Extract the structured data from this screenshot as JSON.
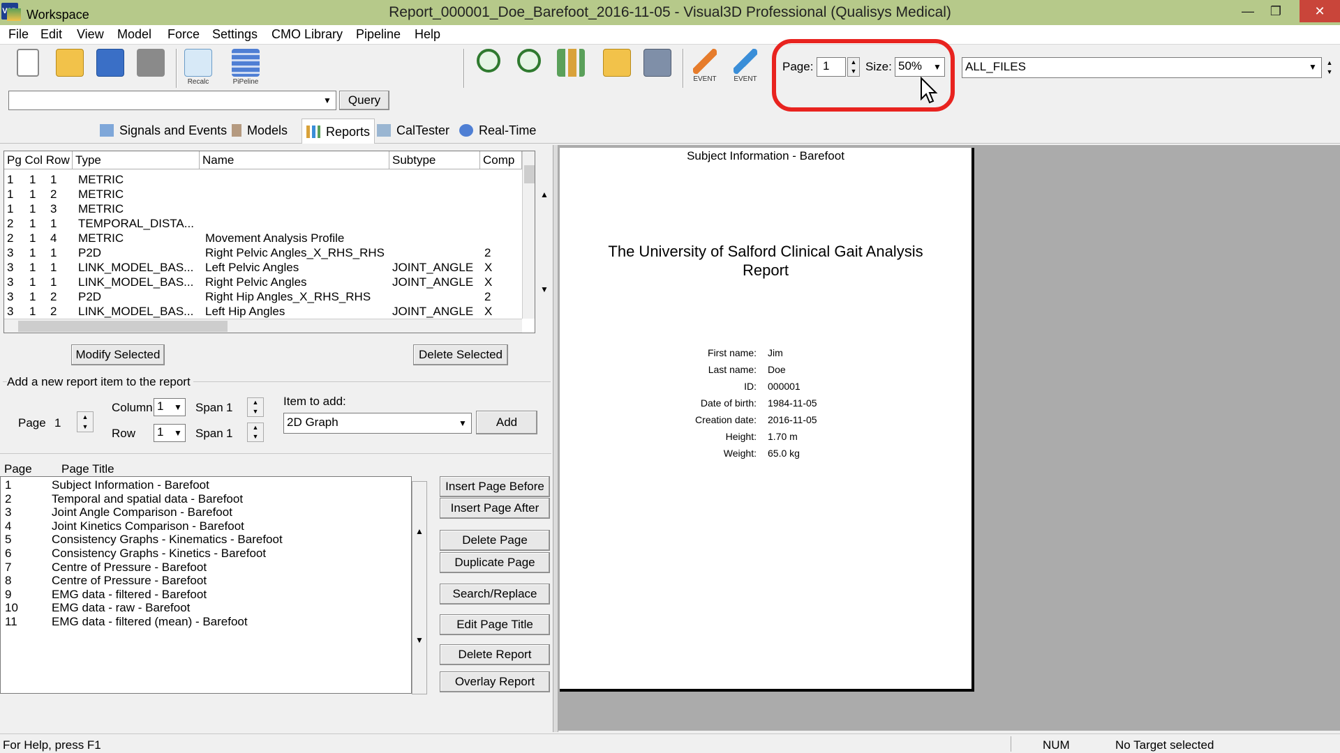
{
  "window": {
    "title": "Report_000001_Doe_Barefoot_2016-11-05 - Visual3D Professional (Qualisys Medical)",
    "app_icon_text": "V3D",
    "minimize": "—",
    "maximize": "❐",
    "close": "✕"
  },
  "menu": [
    "File",
    "Edit",
    "View",
    "Model",
    "Force",
    "Settings",
    "CMO Library",
    "Pipeline",
    "Help"
  ],
  "toolbar": {
    "recalc_caption": "Recalc",
    "pipeline_caption": "PiPeline",
    "event1_caption": "EVENT",
    "event2_caption": "EVENT",
    "page_label": "Page:",
    "page_value": "1",
    "size_label": "Size:",
    "size_value": "50%",
    "files_value": "ALL_FILES",
    "query_label": "Query",
    "query_value": ""
  },
  "tabs": [
    "Workspace",
    "Signals and Events",
    "Models",
    "Reports",
    "CalTester",
    "Real-Time"
  ],
  "grid": {
    "headers": [
      "Pg Col Row",
      "Type",
      "Name",
      "Subtype",
      "Comp"
    ],
    "rows": [
      {
        "pg": "1",
        "col": "1",
        "row": "1",
        "type": "METRIC",
        "name": "",
        "subtype": "",
        "comp": ""
      },
      {
        "pg": "1",
        "col": "1",
        "row": "2",
        "type": "METRIC",
        "name": "",
        "subtype": "",
        "comp": ""
      },
      {
        "pg": "1",
        "col": "1",
        "row": "3",
        "type": "METRIC",
        "name": "",
        "subtype": "",
        "comp": ""
      },
      {
        "pg": "2",
        "col": "1",
        "row": "1",
        "type": "TEMPORAL_DISTA...",
        "name": "",
        "subtype": "",
        "comp": ""
      },
      {
        "pg": "2",
        "col": "1",
        "row": "4",
        "type": "METRIC",
        "name": "Movement Analysis Profile",
        "subtype": "",
        "comp": ""
      },
      {
        "pg": "3",
        "col": "1",
        "row": "1",
        "type": "P2D",
        "name": "Right Pelvic Angles_X_RHS_RHS",
        "subtype": "",
        "comp": "2"
      },
      {
        "pg": "3",
        "col": "1",
        "row": "1",
        "type": "LINK_MODEL_BAS...",
        "name": "Left Pelvic Angles",
        "subtype": "JOINT_ANGLE",
        "comp": "X"
      },
      {
        "pg": "3",
        "col": "1",
        "row": "1",
        "type": "LINK_MODEL_BAS...",
        "name": "Right Pelvic Angles",
        "subtype": "JOINT_ANGLE",
        "comp": "X"
      },
      {
        "pg": "3",
        "col": "1",
        "row": "2",
        "type": "P2D",
        "name": "Right Hip Angles_X_RHS_RHS",
        "subtype": "",
        "comp": "2"
      },
      {
        "pg": "3",
        "col": "1",
        "row": "2",
        "type": "LINK_MODEL_BAS...",
        "name": "Left Hip Angles",
        "subtype": "JOINT_ANGLE",
        "comp": "X"
      }
    ]
  },
  "buttons": {
    "modify_selected": "Modify Selected",
    "delete_selected": "Delete Selected",
    "add": "Add",
    "insert_before": "Insert Page Before",
    "insert_after": "Insert Page After",
    "delete_page": "Delete Page",
    "duplicate_page": "Duplicate Page",
    "search_replace": "Search/Replace",
    "edit_page_title": "Edit Page Title",
    "delete_report": "Delete Report",
    "overlay_report": "Overlay Report"
  },
  "add_item": {
    "legend": "Add a new report item to the report",
    "page_label": "Page",
    "page_value": "1",
    "column_label": "Column",
    "column_value": "1",
    "row_label": "Row",
    "row_value": "1",
    "span_label": "Span",
    "span1_value": "1",
    "span2_value": "1",
    "item_label": "Item to add:",
    "item_value": "2D Graph"
  },
  "pages": {
    "headers": [
      "Page",
      "Page Title"
    ],
    "items": [
      {
        "num": "1",
        "title": "Subject Information - Barefoot"
      },
      {
        "num": "2",
        "title": "Temporal and spatial data - Barefoot"
      },
      {
        "num": "3",
        "title": "Joint Angle Comparison - Barefoot"
      },
      {
        "num": "4",
        "title": "Joint Kinetics Comparison - Barefoot"
      },
      {
        "num": "5",
        "title": "Consistency Graphs - Kinematics - Barefoot"
      },
      {
        "num": "6",
        "title": "Consistency Graphs - Kinetics - Barefoot"
      },
      {
        "num": "7",
        "title": "Centre of Pressure - Barefoot"
      },
      {
        "num": "8",
        "title": "Centre of Pressure - Barefoot"
      },
      {
        "num": "9",
        "title": "EMG data - filtered - Barefoot"
      },
      {
        "num": "10",
        "title": "EMG data - raw - Barefoot"
      },
      {
        "num": "11",
        "title": "EMG data - filtered (mean) - Barefoot"
      }
    ]
  },
  "preview": {
    "header": "Subject Information - Barefoot",
    "title_line1": "The University of Salford Clinical Gait Analysis",
    "title_line2": "Report",
    "fields": [
      {
        "label": "First name:",
        "value": "Jim"
      },
      {
        "label": "Last name:",
        "value": "Doe"
      },
      {
        "label": "ID:",
        "value": "000001"
      },
      {
        "label": "Date of birth:",
        "value": "1984-11-05"
      },
      {
        "label": "Creation date:",
        "value": "2016-11-05"
      },
      {
        "label": "Height:",
        "value": "1.70 m"
      },
      {
        "label": "Weight:",
        "value": "65.0 kg"
      }
    ]
  },
  "status": {
    "help": "For Help, press F1",
    "num": "NUM",
    "target": "No Target selected"
  },
  "colors": {
    "title_bar": "#b6c98a",
    "highlight": "#e8231f",
    "close": "#c9453a"
  }
}
